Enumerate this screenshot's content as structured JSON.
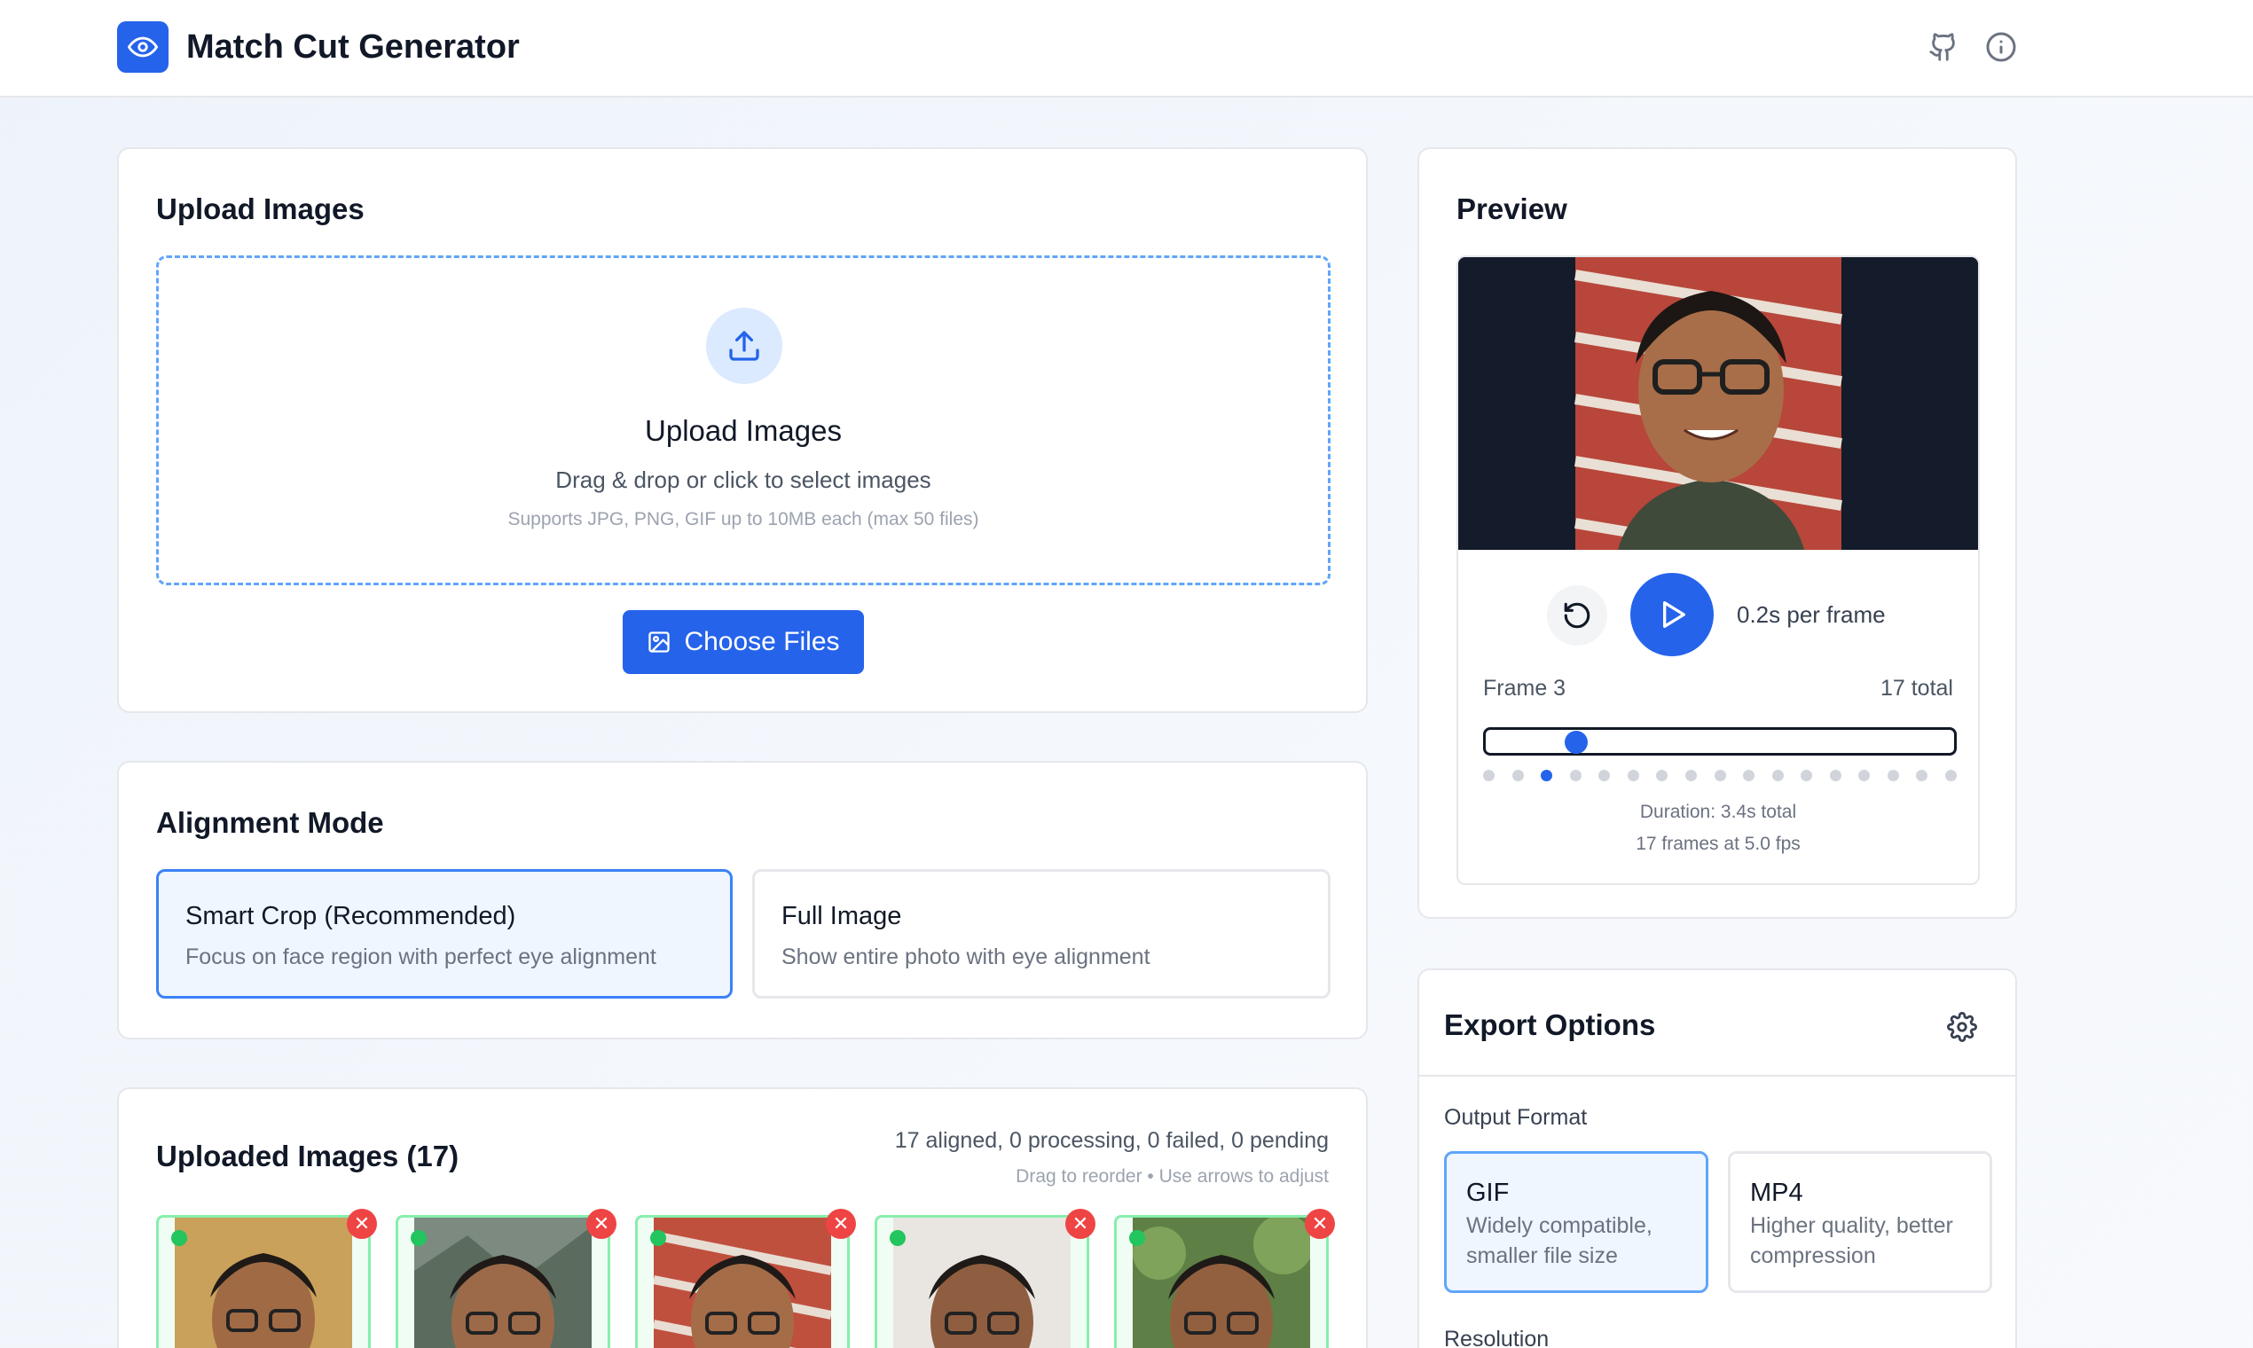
{
  "header": {
    "title": "Match Cut Generator",
    "logo_icon": "eye-icon",
    "github_icon": "github-icon",
    "info_icon": "info-icon"
  },
  "upload": {
    "title": "Upload Images",
    "dropzone_title": "Upload Images",
    "dropzone_subtitle": "Drag & drop or click to select images",
    "dropzone_hint": "Supports JPG, PNG, GIF up to 10MB each (max 50 files)",
    "choose_button": "Choose Files"
  },
  "alignment": {
    "title": "Alignment Mode",
    "options": [
      {
        "title": "Smart Crop (Recommended)",
        "description": "Focus on face region with perfect eye alignment",
        "selected": true
      },
      {
        "title": "Full Image",
        "description": "Show entire photo with eye alignment",
        "selected": false
      }
    ]
  },
  "uploaded": {
    "title": "Uploaded Images (17)",
    "status": "17 aligned, 0 processing, 0 failed, 0 pending",
    "hint": "Drag to reorder • Use arrows to adjust",
    "remove_symbol": "✕",
    "thumbnails": [
      {
        "bg": "#c9a15a",
        "status": "aligned"
      },
      {
        "bg": "#7d8a80",
        "status": "aligned"
      },
      {
        "bg": "#c0503e",
        "status": "aligned"
      },
      {
        "bg": "#e9e6e1",
        "status": "aligned"
      },
      {
        "bg": "#5e7f45",
        "status": "aligned"
      }
    ]
  },
  "preview": {
    "title": "Preview",
    "speed": "0.2s per frame",
    "frame_label": "Frame 3",
    "frame_total": "17 total",
    "current_frame": 3,
    "total_frames": 17,
    "duration": "Duration: 3.4s total",
    "frames_info": "17 frames at 5.0 fps"
  },
  "export": {
    "title": "Export Options",
    "output_format_label": "Output Format",
    "formats": [
      {
        "title": "GIF",
        "description": "Widely compatible, smaller file size",
        "selected": true
      },
      {
        "title": "MP4",
        "description": "Higher quality, better compression",
        "selected": false
      }
    ],
    "resolution_label": "Resolution"
  },
  "colors": {
    "accent": "#2563eb",
    "success": "#22c55e",
    "danger": "#ef4444"
  }
}
